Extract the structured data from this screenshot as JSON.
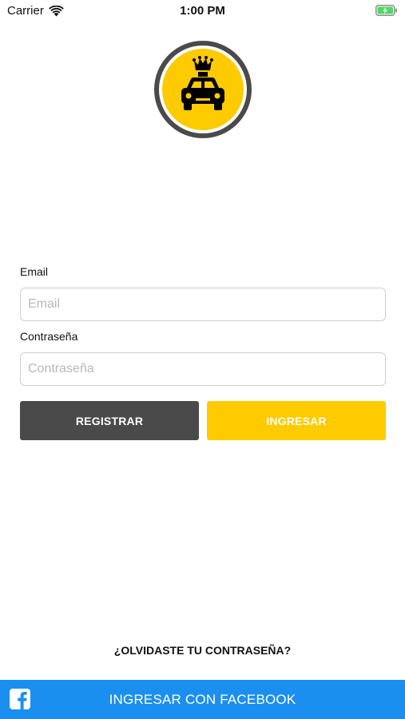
{
  "status_bar": {
    "carrier": "Carrier",
    "time": "1:00 PM",
    "wifi_icon": "wifi-icon",
    "battery_icon": "battery-charging-icon",
    "battery_color": "#4cd964"
  },
  "logo": {
    "icon": "taxi-crown-logo",
    "colors": {
      "ring": "#4a4a4a",
      "fill": "#fecb00",
      "car": "#000000"
    }
  },
  "form": {
    "email_label": "Email",
    "email_placeholder": "Email",
    "email_value": "",
    "password_label": "Contraseña",
    "password_placeholder": "Contraseña",
    "password_value": ""
  },
  "actions": {
    "register_label": "REGISTRAR",
    "login_label": "INGRESAR",
    "register_color": "#4a4a4a",
    "login_color": "#fecb00"
  },
  "forgot_password": "¿OLVIDASTE TU CONTRASEÑA?",
  "facebook": {
    "label": "INGRESAR CON FACEBOOK",
    "icon": "facebook-icon",
    "color": "#1b8ff0"
  }
}
